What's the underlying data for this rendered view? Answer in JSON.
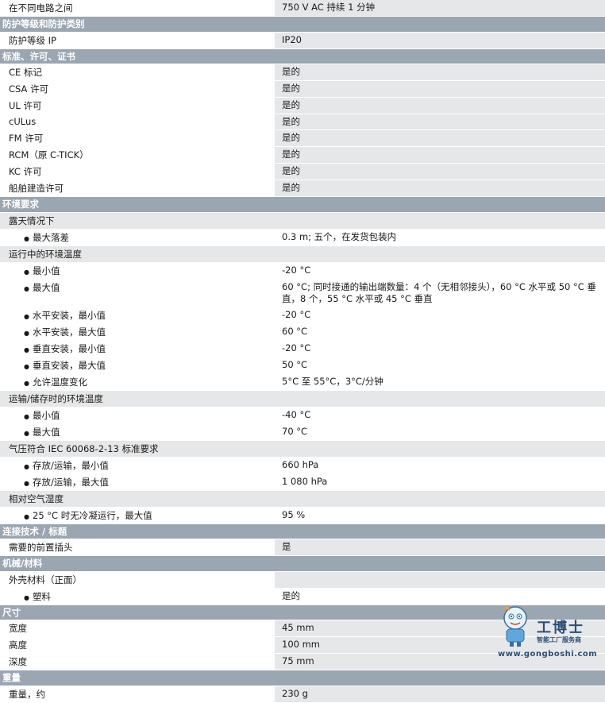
{
  "rows": [
    {
      "kind": "kv",
      "label": "在不同电路之间",
      "value": "750 V AC 持续 1 分钟"
    },
    {
      "kind": "sec",
      "label": "防护等级和防护类别"
    },
    {
      "kind": "kv",
      "label": "防护等级 IP",
      "value": "IP20"
    },
    {
      "kind": "sec",
      "label": "标准、许可、证书"
    },
    {
      "kind": "kv",
      "label": "CE 标记",
      "value": "是的"
    },
    {
      "kind": "kv",
      "label": "CSA 许可",
      "value": "是的"
    },
    {
      "kind": "kv",
      "label": "UL 许可",
      "value": "是的"
    },
    {
      "kind": "kv",
      "label": "cULus",
      "value": "是的"
    },
    {
      "kind": "kv",
      "label": "FM 许可",
      "value": "是的"
    },
    {
      "kind": "kv",
      "label": "RCM（原 C-TICK）",
      "value": "是的"
    },
    {
      "kind": "kv",
      "label": "KC 许可",
      "value": "是的"
    },
    {
      "kind": "kv",
      "label": "船舶建造许可",
      "value": "是的"
    },
    {
      "kind": "sec",
      "label": "环境要求"
    },
    {
      "kind": "sub",
      "label": "露天情况下",
      "value": ""
    },
    {
      "kind": "bul",
      "label": "最大落差",
      "value": "0.3 m; 五个，在发货包装内"
    },
    {
      "kind": "sub",
      "label": "运行中的环境温度",
      "value": ""
    },
    {
      "kind": "bul",
      "label": "最小值",
      "value": "-20 °C"
    },
    {
      "kind": "bul",
      "label": "最大值",
      "value": "60 °C; 同时接通的输出端数量：4 个（无相邻接头），60 °C 水平或 50 °C 垂直，8 个，55 °C 水平或 45 °C 垂直"
    },
    {
      "kind": "bul",
      "label": "水平安装，最小值",
      "value": "-20 °C"
    },
    {
      "kind": "bul",
      "label": "水平安装，最大值",
      "value": "60 °C"
    },
    {
      "kind": "bul",
      "label": "垂直安装，最小值",
      "value": "-20 °C"
    },
    {
      "kind": "bul",
      "label": "垂直安装，最大值",
      "value": "50 °C"
    },
    {
      "kind": "bul",
      "label": "允许温度变化",
      "value": "5°C 至 55°C，3°C/分钟"
    },
    {
      "kind": "sub",
      "label": "运输/储存时的环境温度",
      "value": ""
    },
    {
      "kind": "bul",
      "label": "最小值",
      "value": "-40 °C"
    },
    {
      "kind": "bul",
      "label": "最大值",
      "value": "70 °C"
    },
    {
      "kind": "sub",
      "label": "气压符合 IEC 60068-2-13 标准要求",
      "value": ""
    },
    {
      "kind": "bul",
      "label": "存放/运输，最小值",
      "value": "660 hPa"
    },
    {
      "kind": "bul",
      "label": "存放/运输，最大值",
      "value": "1 080 hPa"
    },
    {
      "kind": "sub",
      "label": "相对空气湿度",
      "value": ""
    },
    {
      "kind": "bul",
      "label": "25 °C 时无冷凝运行，最大值",
      "value": "95 %"
    },
    {
      "kind": "sec",
      "label": "连接技术 / 标题"
    },
    {
      "kind": "kv",
      "label": "需要的前置插头",
      "value": "是"
    },
    {
      "kind": "sec",
      "label": "机械/材料"
    },
    {
      "kind": "plain",
      "label": "外壳材料（正面）",
      "value": ""
    },
    {
      "kind": "bul",
      "label": "塑料",
      "value": "是的"
    },
    {
      "kind": "sec",
      "label": "尺寸"
    },
    {
      "kind": "kv",
      "label": "宽度",
      "value": "45 mm"
    },
    {
      "kind": "kv",
      "label": "高度",
      "value": "100 mm"
    },
    {
      "kind": "kv",
      "label": "深度",
      "value": "75 mm"
    },
    {
      "kind": "sec",
      "label": "重量"
    },
    {
      "kind": "kv",
      "label": "重量，约",
      "value": "230 g"
    }
  ],
  "bullet_glyph": "●",
  "watermark": {
    "brand": "工博士",
    "tagline": "智能工厂服务商",
    "url": "www.gongboshi.com"
  }
}
